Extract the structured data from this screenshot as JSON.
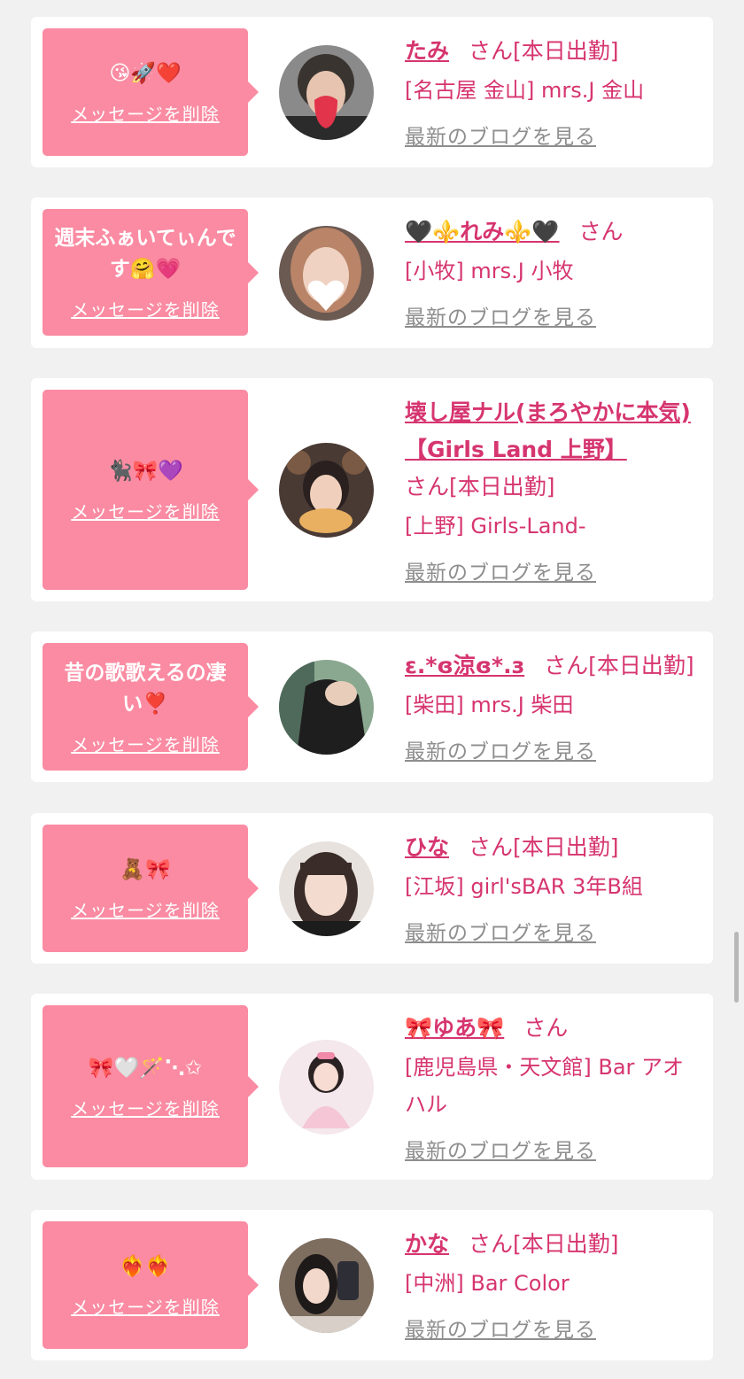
{
  "delete_label": "メッセージを削除",
  "blog_label": "最新のブログを見る",
  "colors": {
    "background": "#f1f1f1",
    "card": "#ffffff",
    "bubble": "#fa8ba2",
    "accent": "#d6356f",
    "muted": "#8e8e8e"
  },
  "cards": [
    {
      "message": "😘🚀❤️",
      "name": "たみ",
      "san": "さん[本日出勤]",
      "shop": "[名古屋 金山] mrs.J 金山"
    },
    {
      "message": "週末ふぁいてぃんです🤗💗",
      "name": "🖤⚜️れみ⚜️🖤",
      "san": "さん",
      "shop": "[小牧] mrs.J 小牧"
    },
    {
      "message": "🐈‍⬛🎀💜",
      "name": "壊し屋ナル(まろやかに本気)【Girls Land 上野】",
      "san": "さん[本日出勤]",
      "shop": "[上野] Girls-Land-"
    },
    {
      "message": "昔の歌歌えるの凄い❣️",
      "name": "ε.*ɞ涼ɞ*.з",
      "san": "さん[本日出勤]",
      "shop": "[柴田] mrs.J 柴田"
    },
    {
      "message": "🧸🎀",
      "name": "ひな",
      "san": "さん[本日出勤]",
      "shop": "[江坂] girl'sBAR 3年B組"
    },
    {
      "message": "🎀🤍🪄⋱✩",
      "name": "🎀ゆあ🎀",
      "san": "さん",
      "shop": "[鹿児島県・天文館] Bar アオハル"
    },
    {
      "message": "❤️‍🔥❤️‍🔥",
      "name": "かな",
      "san": "さん[本日出勤]",
      "shop": "[中洲] Bar Color"
    }
  ]
}
